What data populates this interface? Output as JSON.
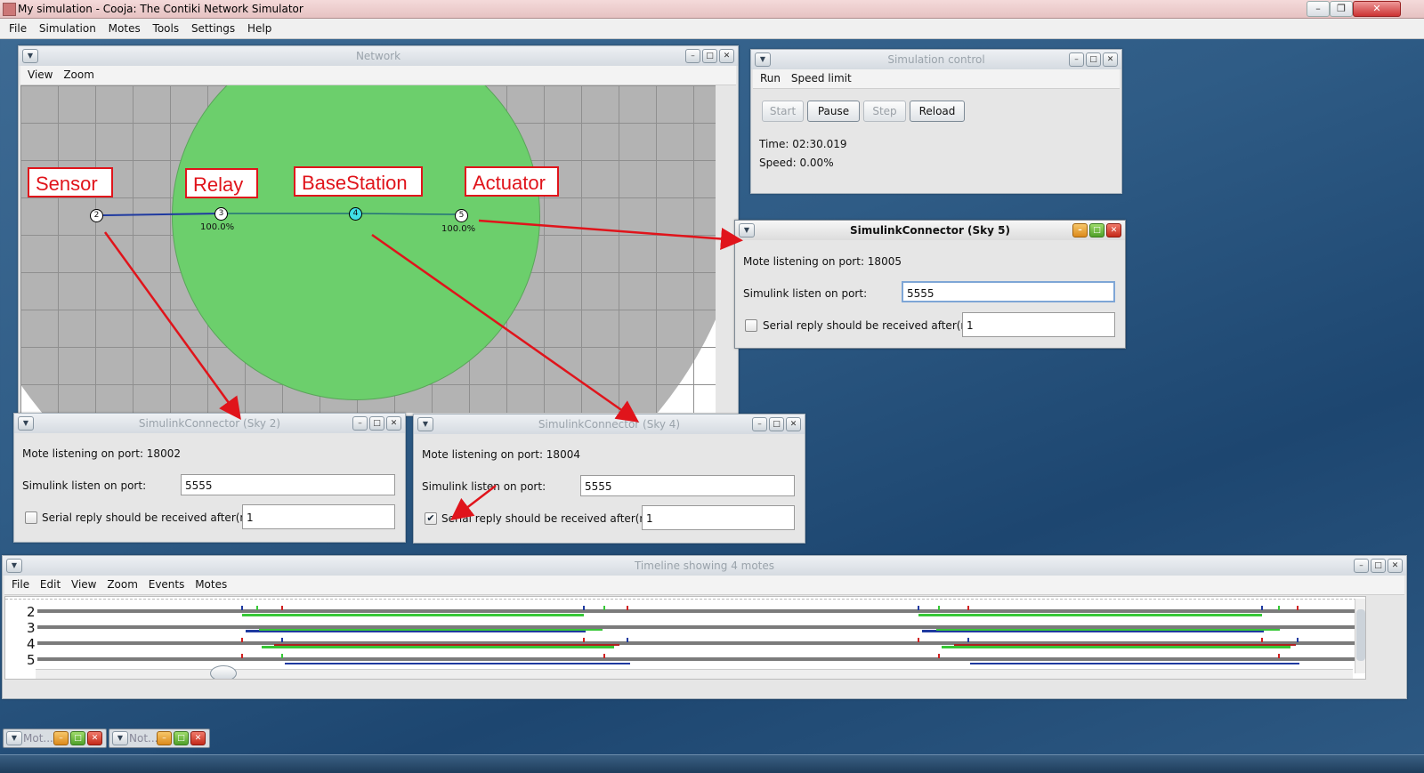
{
  "app": {
    "title": "My simulation - Cooja: The Contiki Network Simulator",
    "menu": [
      "File",
      "Simulation",
      "Motes",
      "Tools",
      "Settings",
      "Help"
    ]
  },
  "network": {
    "title": "Network",
    "menu": [
      "View",
      "Zoom"
    ],
    "labels": {
      "sensor": "Sensor",
      "relay": "Relay",
      "base": "BaseStation",
      "actuator": "Actuator"
    },
    "nodes": {
      "n2": "2",
      "n3": "3",
      "n4": "4",
      "n5": "5"
    },
    "pct3": "100.0%",
    "pct5": "100.0%"
  },
  "simcontrol": {
    "title": "Simulation control",
    "menu": [
      "Run",
      "Speed limit"
    ],
    "buttons": {
      "start": "Start",
      "pause": "Pause",
      "step": "Step",
      "reload": "Reload"
    },
    "time": "Time: 02:30.019",
    "speed": "Speed: 0.00%"
  },
  "sky5": {
    "title": "SimulinkConnector (Sky 5)",
    "mote_port": "Mote listening on port: 18005",
    "listen_label": "Simulink listen on port:",
    "listen_value": "5555",
    "reply_label": "Serial reply should be received after(ms):",
    "reply_value": "1",
    "checked": false
  },
  "sky2": {
    "title": "SimulinkConnector (Sky 2)",
    "mote_port": "Mote listening on port: 18002",
    "listen_label": "Simulink listen on port:",
    "listen_value": "5555",
    "reply_label": "Serial reply should be received after(ms):",
    "reply_value": "1",
    "checked": false
  },
  "sky4": {
    "title": "SimulinkConnector (Sky 4)",
    "mote_port": "Mote listening on port: 18004",
    "listen_label": "Simulink listen on port:",
    "listen_value": "5555",
    "reply_label": "Serial reply should be received after(ms):",
    "reply_value": "1",
    "checked": true
  },
  "timeline": {
    "title": "Timeline showing 4 motes",
    "menu": [
      "File",
      "Edit",
      "View",
      "Zoom",
      "Events",
      "Motes"
    ],
    "motes": [
      "2",
      "3",
      "4",
      "5"
    ]
  },
  "taskbar": {
    "mini1": "Mot...",
    "mini2": "Not..."
  },
  "colors": {
    "radio_green": "#6ccf6c",
    "annotation_red": "#e0141b",
    "link_blue": "#1f3aa0"
  }
}
